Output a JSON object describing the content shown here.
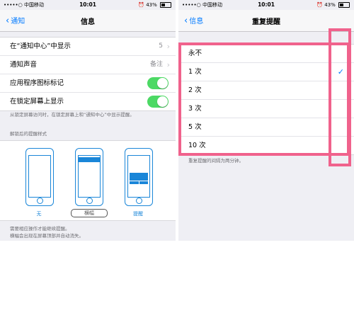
{
  "left": {
    "status": {
      "carrier": "•••••○ 中国移动",
      "time": "10:01",
      "battery": "43%"
    },
    "nav": {
      "back": "通知",
      "title": "信息"
    },
    "rows": [
      {
        "label": "在“通知中心”中显示",
        "value": "5"
      },
      {
        "label": "通知声音",
        "value": "备注"
      },
      {
        "label": "应用程序图标标记"
      },
      {
        "label": "在锁定屏幕上显示"
      }
    ],
    "note": "从锁定屏幕访问时，在锁定屏幕上和“通知中心”中显示提醒。",
    "style_header": "解锁后的提醒样式",
    "styles": [
      "无",
      "横幅",
      "提醒"
    ],
    "footer": [
      "需要相应操作才能继续提醒。",
      "横幅会出现在屏幕顶部并自动消失。"
    ]
  },
  "right": {
    "status": {
      "carrier": "•••••○ 中国移动",
      "time": "10:01",
      "battery": "43%"
    },
    "nav": {
      "back": "信息",
      "title": "重复提醒"
    },
    "options": [
      "永不",
      "1 次",
      "2 次",
      "3 次",
      "5 次",
      "10 次"
    ],
    "selected": "1 次",
    "note": "重复提醒的间隔为两分钟。"
  },
  "colors": {
    "accent": "#007aff",
    "toggle_on": "#4cd964",
    "highlight": "#f0628c",
    "illustration": "#1a86d8"
  }
}
